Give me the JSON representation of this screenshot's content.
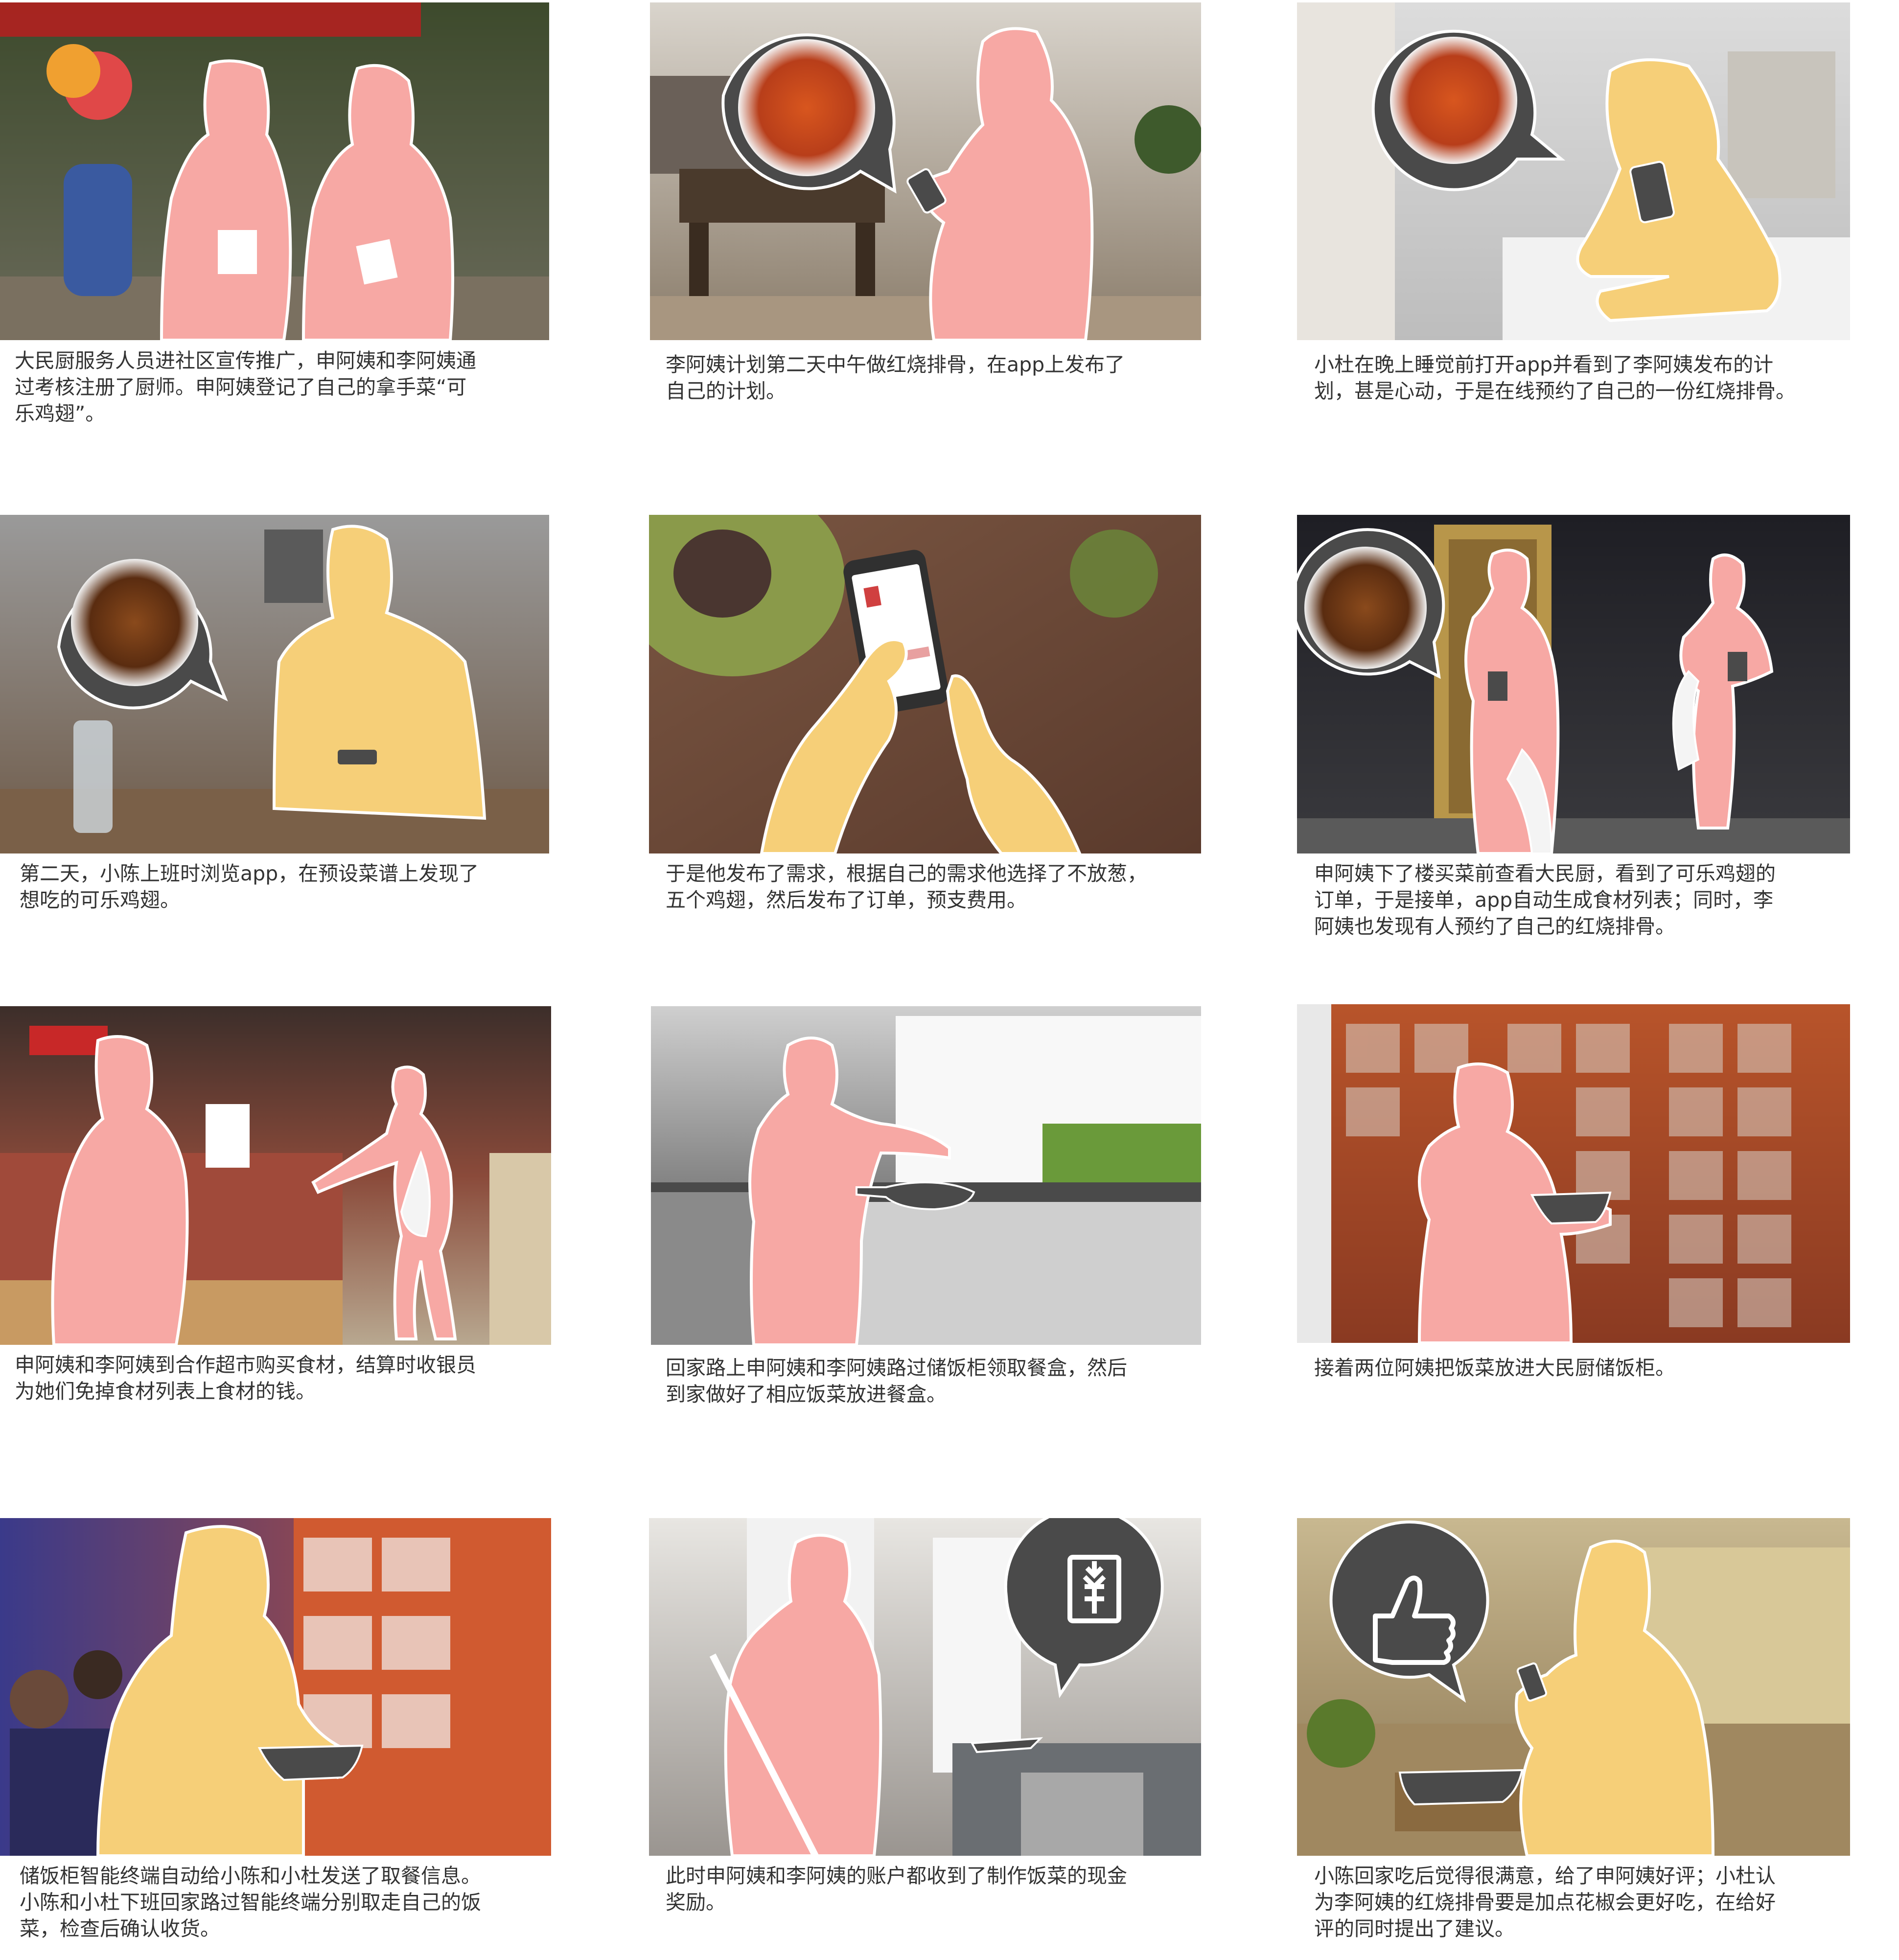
{
  "colors": {
    "pink": "#f7a8a4",
    "yellow": "#f6cf78",
    "bubble": "#4a4a4a",
    "outline": "#ffffff"
  },
  "panels": [
    {
      "caption": "大民厨服务人员进社区宣传推广，申阿姨和李阿姨通\n过考核注册了厨师。申阿姨登记了自己的拿手菜“可\n乐鸡翅”。"
    },
    {
      "caption": "李阿姨计划第二天中午做红烧排骨，在app上发布了\n自己的计划。"
    },
    {
      "caption": "小杜在晚上睡觉前打开app并看到了李阿姨发布的计\n划，甚是心动，于是在线预约了自己的一份红烧排骨。"
    },
    {
      "caption": "第二天，小陈上班时浏览app，在预设菜谱上发现了\n想吃的可乐鸡翅。"
    },
    {
      "caption": "于是他发布了需求，根据自己的需求他选择了不放葱，\n五个鸡翅，然后发布了订单，预支费用。"
    },
    {
      "caption": "申阿姨下了楼买菜前查看大民厨，看到了可乐鸡翅的\n订单，于是接单，app自动生成食材列表；同时，李\n阿姨也发现有人预约了自己的红烧排骨。"
    },
    {
      "caption": "申阿姨和李阿姨到合作超市购买食材，结算时收银员\n为她们免掉食材列表上食材的钱。"
    },
    {
      "caption": "回家路上申阿姨和李阿姨路过储饭柜领取餐盒，然后\n到家做好了相应饭菜放进餐盒。"
    },
    {
      "caption": "接着两位阿姨把饭菜放进大民厨储饭柜。"
    },
    {
      "caption": "储饭柜智能终端自动给小陈和小杜发送了取餐信息。\n小陈和小杜下班回家路过智能终端分别取走自己的饭\n菜，检查后确认收货。"
    },
    {
      "caption": "此时申阿姨和李阿姨的账户都收到了制作饭菜的现金\n奖励。"
    },
    {
      "caption": "小陈回家吃后觉得很满意，给了申阿姨好评；小杜认\n为李阿姨的红烧排骨要是加点花椒会更好吃，在给好\n评的同时提出了建议。"
    }
  ]
}
